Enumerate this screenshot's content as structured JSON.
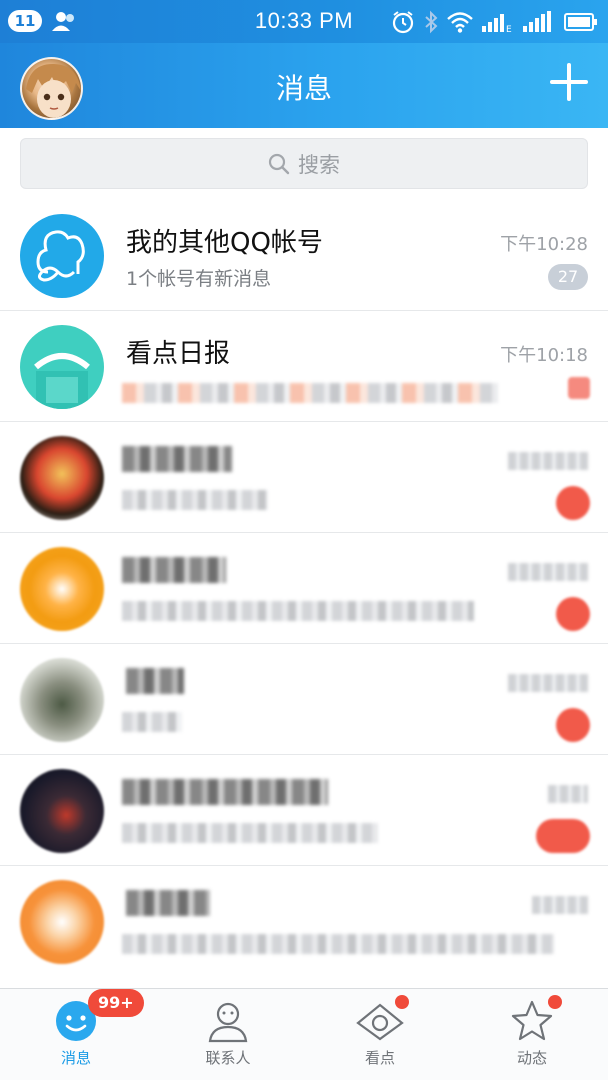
{
  "status_bar": {
    "notification_count": "11",
    "time": "10:33 PM"
  },
  "header": {
    "title": "消息"
  },
  "search": {
    "placeholder": "搜索"
  },
  "conversations": [
    {
      "name": "我的其他QQ帐号",
      "preview": "1个帐号有新消息",
      "time": "下午10:28",
      "unread": "27"
    },
    {
      "name": "看点日报",
      "time": "下午10:18"
    }
  ],
  "tabs": [
    {
      "label": "消息",
      "badge": "99+"
    },
    {
      "label": "联系人"
    },
    {
      "label": "看点"
    },
    {
      "label": "动态"
    }
  ],
  "colors": {
    "accent": "#1a9be6",
    "header_gradient_start": "#1f86dc",
    "header_gradient_end": "#3ab6f4",
    "badge_red": "#f04a3a",
    "unread_gray": "#c8cfd8"
  }
}
